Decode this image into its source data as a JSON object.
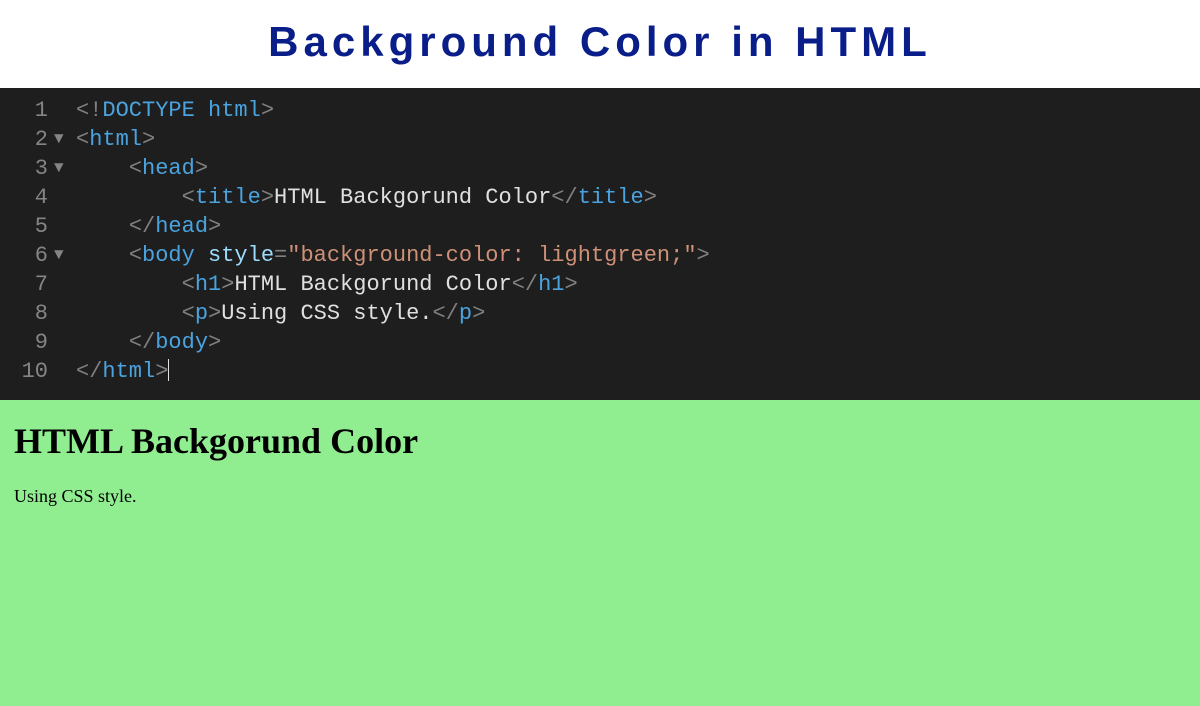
{
  "header": {
    "title": "Background Color in HTML"
  },
  "editor": {
    "lines": [
      {
        "num": "1",
        "fold": "",
        "indent": "",
        "tokens": [
          {
            "t": "tag-bracket",
            "v": "<!"
          },
          {
            "t": "tag-name",
            "v": "DOCTYPE"
          },
          {
            "t": "text",
            "v": " "
          },
          {
            "t": "tag-name",
            "v": "html"
          },
          {
            "t": "tag-bracket",
            "v": ">"
          }
        ]
      },
      {
        "num": "2",
        "fold": "▼",
        "indent": "",
        "tokens": [
          {
            "t": "tag-bracket",
            "v": "<"
          },
          {
            "t": "tag-name",
            "v": "html"
          },
          {
            "t": "tag-bracket",
            "v": ">"
          }
        ]
      },
      {
        "num": "3",
        "fold": "▼",
        "indent": "    ",
        "tokens": [
          {
            "t": "tag-bracket",
            "v": "<"
          },
          {
            "t": "tag-name",
            "v": "head"
          },
          {
            "t": "tag-bracket",
            "v": ">"
          }
        ]
      },
      {
        "num": "4",
        "fold": "",
        "indent": "        ",
        "tokens": [
          {
            "t": "tag-bracket",
            "v": "<"
          },
          {
            "t": "tag-name",
            "v": "title"
          },
          {
            "t": "tag-bracket",
            "v": ">"
          },
          {
            "t": "text",
            "v": "HTML Backgorund Color"
          },
          {
            "t": "tag-bracket",
            "v": "</"
          },
          {
            "t": "tag-name",
            "v": "title"
          },
          {
            "t": "tag-bracket",
            "v": ">"
          }
        ]
      },
      {
        "num": "5",
        "fold": "",
        "indent": "    ",
        "tokens": [
          {
            "t": "tag-bracket",
            "v": "</"
          },
          {
            "t": "tag-name",
            "v": "head"
          },
          {
            "t": "tag-bracket",
            "v": ">"
          }
        ]
      },
      {
        "num": "6",
        "fold": "▼",
        "indent": "    ",
        "tokens": [
          {
            "t": "tag-bracket",
            "v": "<"
          },
          {
            "t": "tag-name",
            "v": "body"
          },
          {
            "t": "text",
            "v": " "
          },
          {
            "t": "attr-name",
            "v": "style"
          },
          {
            "t": "tag-bracket",
            "v": "="
          },
          {
            "t": "attr-value",
            "v": "\"background-color: lightgreen;\""
          },
          {
            "t": "tag-bracket",
            "v": ">"
          }
        ]
      },
      {
        "num": "7",
        "fold": "",
        "indent": "        ",
        "tokens": [
          {
            "t": "tag-bracket",
            "v": "<"
          },
          {
            "t": "tag-name",
            "v": "h1"
          },
          {
            "t": "tag-bracket",
            "v": ">"
          },
          {
            "t": "text",
            "v": "HTML Backgorund Color"
          },
          {
            "t": "tag-bracket",
            "v": "</"
          },
          {
            "t": "tag-name",
            "v": "h1"
          },
          {
            "t": "tag-bracket",
            "v": ">"
          }
        ]
      },
      {
        "num": "8",
        "fold": "",
        "indent": "        ",
        "tokens": [
          {
            "t": "tag-bracket",
            "v": "<"
          },
          {
            "t": "tag-name",
            "v": "p"
          },
          {
            "t": "tag-bracket",
            "v": ">"
          },
          {
            "t": "text",
            "v": "Using CSS style."
          },
          {
            "t": "tag-bracket",
            "v": "</"
          },
          {
            "t": "tag-name",
            "v": "p"
          },
          {
            "t": "tag-bracket",
            "v": ">"
          }
        ]
      },
      {
        "num": "9",
        "fold": "",
        "indent": "    ",
        "tokens": [
          {
            "t": "tag-bracket",
            "v": "</"
          },
          {
            "t": "tag-name",
            "v": "body"
          },
          {
            "t": "tag-bracket",
            "v": ">"
          }
        ]
      },
      {
        "num": "10",
        "fold": "",
        "indent": "",
        "tokens": [
          {
            "t": "tag-bracket",
            "v": "</"
          },
          {
            "t": "tag-name",
            "v": "html"
          },
          {
            "t": "tag-bracket",
            "v": ">"
          }
        ],
        "cursor": true
      }
    ]
  },
  "preview": {
    "heading": "HTML Backgorund Color",
    "paragraph": "Using CSS style.",
    "bgcolor": "lightgreen"
  }
}
